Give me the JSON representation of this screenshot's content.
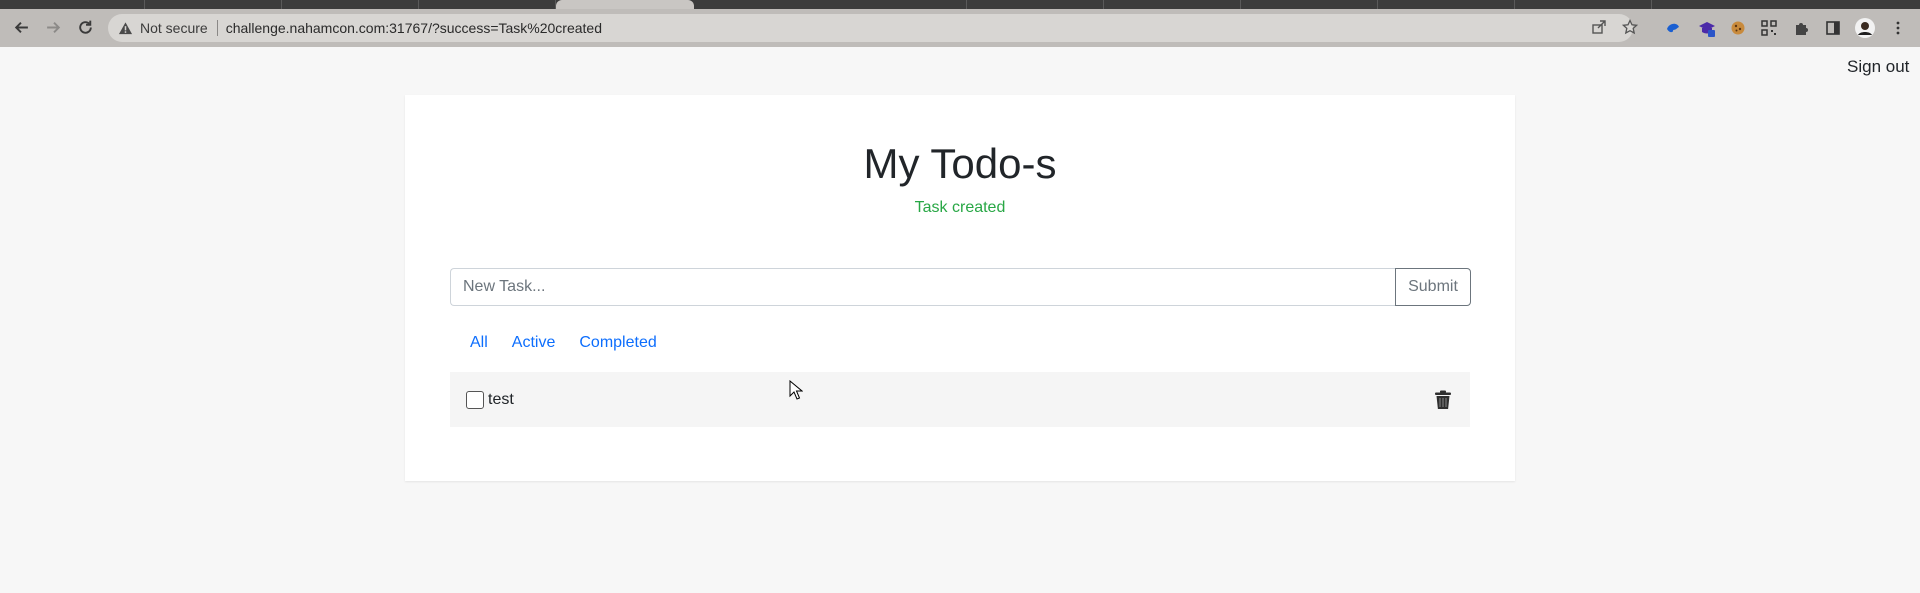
{
  "browser": {
    "security_label": "Not secure",
    "url": "challenge.nahamcon.com:31767/?success=Task%20created",
    "icons": [
      "back-icon",
      "forward-icon",
      "reload-icon",
      "warning-icon",
      "share-icon",
      "star-icon",
      "puzzle-icon",
      "sidepanel-icon",
      "profile-avatar",
      "kebab-menu-icon"
    ]
  },
  "page": {
    "signout_label": "Sign out",
    "title": "My Todo-s",
    "status_message": "Task created",
    "new_task": {
      "value": "",
      "placeholder": "New Task..."
    },
    "submit_label": "Submit",
    "filters": [
      {
        "label": "All"
      },
      {
        "label": "Active"
      },
      {
        "label": "Completed"
      }
    ],
    "todos": [
      {
        "label": "test",
        "checked": false
      }
    ]
  },
  "colors": {
    "accent_link": "#0d6efd",
    "success": "#28a745",
    "page_bg": "#f7f7f7",
    "card_bg": "#ffffff",
    "chrome_toolbar": "#bfbcb9"
  }
}
